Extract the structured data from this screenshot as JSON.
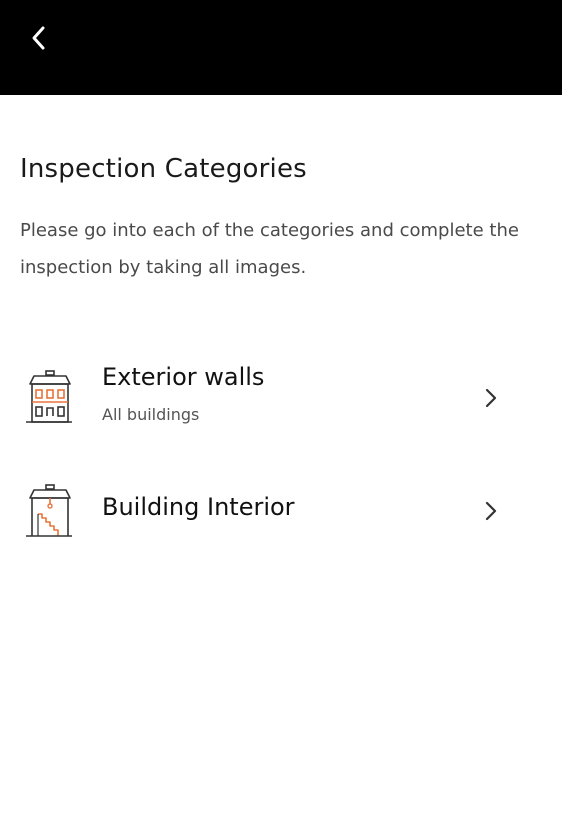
{
  "header": {
    "back_icon": "chevron-left-icon",
    "background": "#000000"
  },
  "page": {
    "title": "Inspection Categories",
    "description": "Please go into each of the categories and complete the inspection by taking all images."
  },
  "categories": [
    {
      "title": "Exterior walls",
      "subtitle": "All buildings",
      "icon": "building-exterior-icon",
      "chevron": "chevron-right-icon"
    },
    {
      "title": "Building Interior",
      "subtitle": "",
      "icon": "building-interior-icon",
      "chevron": "chevron-right-icon"
    }
  ],
  "colors": {
    "icon_accent": "#e8743b",
    "icon_line": "#333333"
  }
}
